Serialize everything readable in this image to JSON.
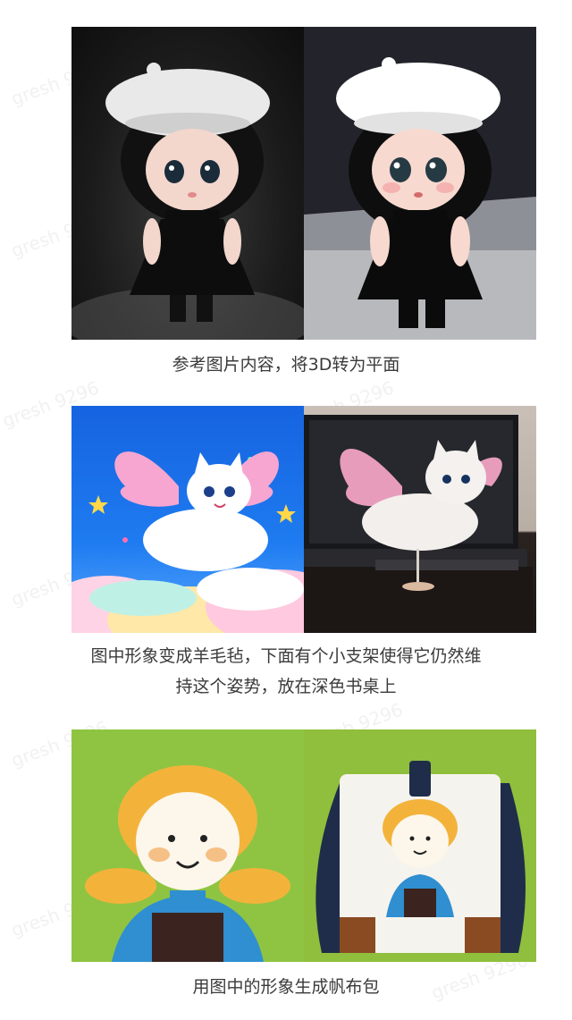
{
  "watermark": "gresh 9296",
  "examples": [
    {
      "caption": "参考图片内容，将3D转为平面"
    },
    {
      "caption_line1": "图中形象变成羊毛毡，下面有个小支架使得它仍然维",
      "caption_line2": "持这个姿势，放在深色书桌上"
    },
    {
      "caption": "用图中的形象生成帆布包"
    }
  ],
  "colors": {
    "caption_text": "#3a3a3a",
    "sky_blue": "#1e7bf0",
    "grass_green": "#8fc442",
    "felt_pink": "#f2a9c8"
  }
}
